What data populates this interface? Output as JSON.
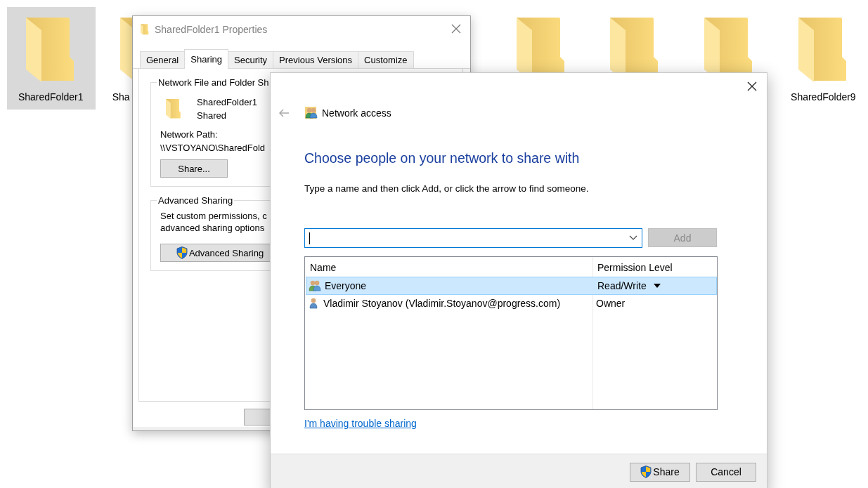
{
  "desktop": {
    "icons": [
      {
        "label": "SharedFolder1",
        "selected": true
      },
      {
        "label": "Sha",
        "selected": false
      },
      {
        "selected": false
      },
      {
        "selected": false
      },
      {
        "selected": false
      },
      {
        "label": "SharedFolder9",
        "selected": false
      }
    ]
  },
  "properties_dialog": {
    "title": "SharedFolder1 Properties",
    "tabs": [
      {
        "label": "General",
        "selected": false
      },
      {
        "label": "Sharing",
        "selected": true
      },
      {
        "label": "Security",
        "selected": false
      },
      {
        "label": "Previous Versions",
        "selected": false
      },
      {
        "label": "Customize",
        "selected": false
      }
    ],
    "network_sharing": {
      "group_title": "Network File and Folder Sh",
      "folder_name": "SharedFolder1",
      "status": "Shared",
      "path_label": "Network Path:",
      "path": "\\\\VSTOYANO\\SharedFold",
      "share_button": "Share..."
    },
    "advanced_sharing": {
      "group_title": "Advanced Sharing",
      "description": [
        "Set custom permissions, c",
        "advanced sharing options"
      ],
      "button": "Advanced Sharing"
    }
  },
  "network_access": {
    "title": "Network access",
    "heading": "Choose people on your network to share with",
    "instruction": "Type a name and then click Add, or click the arrow to find someone.",
    "add_button": {
      "label": "Add",
      "disabled": true
    },
    "table": {
      "columns": [
        "Name",
        "Permission Level"
      ],
      "rows": [
        {
          "kind": "group",
          "name": "Everyone",
          "permission": "Read/Write",
          "selected": true
        },
        {
          "kind": "user",
          "name": "Vladimir Stoyanov (Vladimir.Stoyanov@progress.com)",
          "permission": "Owner",
          "selected": false
        }
      ]
    },
    "help_link": "I'm having trouble sharing",
    "buttons": [
      {
        "label": "Share",
        "kind": "elevated"
      },
      {
        "label": "Cancel",
        "kind": "plain"
      }
    ]
  }
}
